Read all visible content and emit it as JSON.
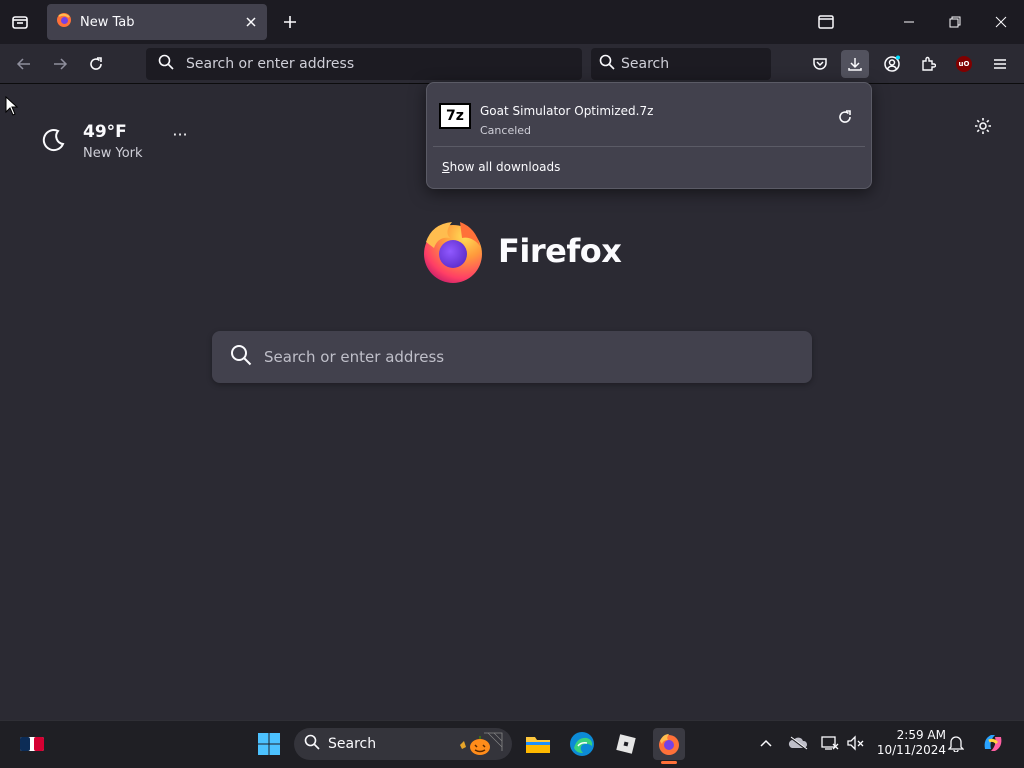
{
  "tab": {
    "title": "New Tab"
  },
  "navbar": {
    "url_placeholder": "Search or enter address",
    "search_placeholder": "Search",
    "ublock_label": "uO"
  },
  "weather": {
    "temperature": "49°F",
    "city": "New York",
    "menu_label": "···"
  },
  "brand": {
    "name": "Firefox"
  },
  "main_search": {
    "placeholder": "Search or enter address"
  },
  "downloads": {
    "items": [
      {
        "filename": "Goat Simulator Optimized.7z",
        "status": "Canceled",
        "icon_label": "7z"
      }
    ],
    "show_all_prefix": "S",
    "show_all_rest": "how all downloads"
  },
  "taskbar": {
    "search_label": "Search",
    "time": "2:59 AM",
    "date": "10/11/2024"
  },
  "colors": {
    "accent": "#ff7139",
    "background": "#2b2a33",
    "toolbar": "#1c1b22",
    "panel": "#42414d"
  }
}
